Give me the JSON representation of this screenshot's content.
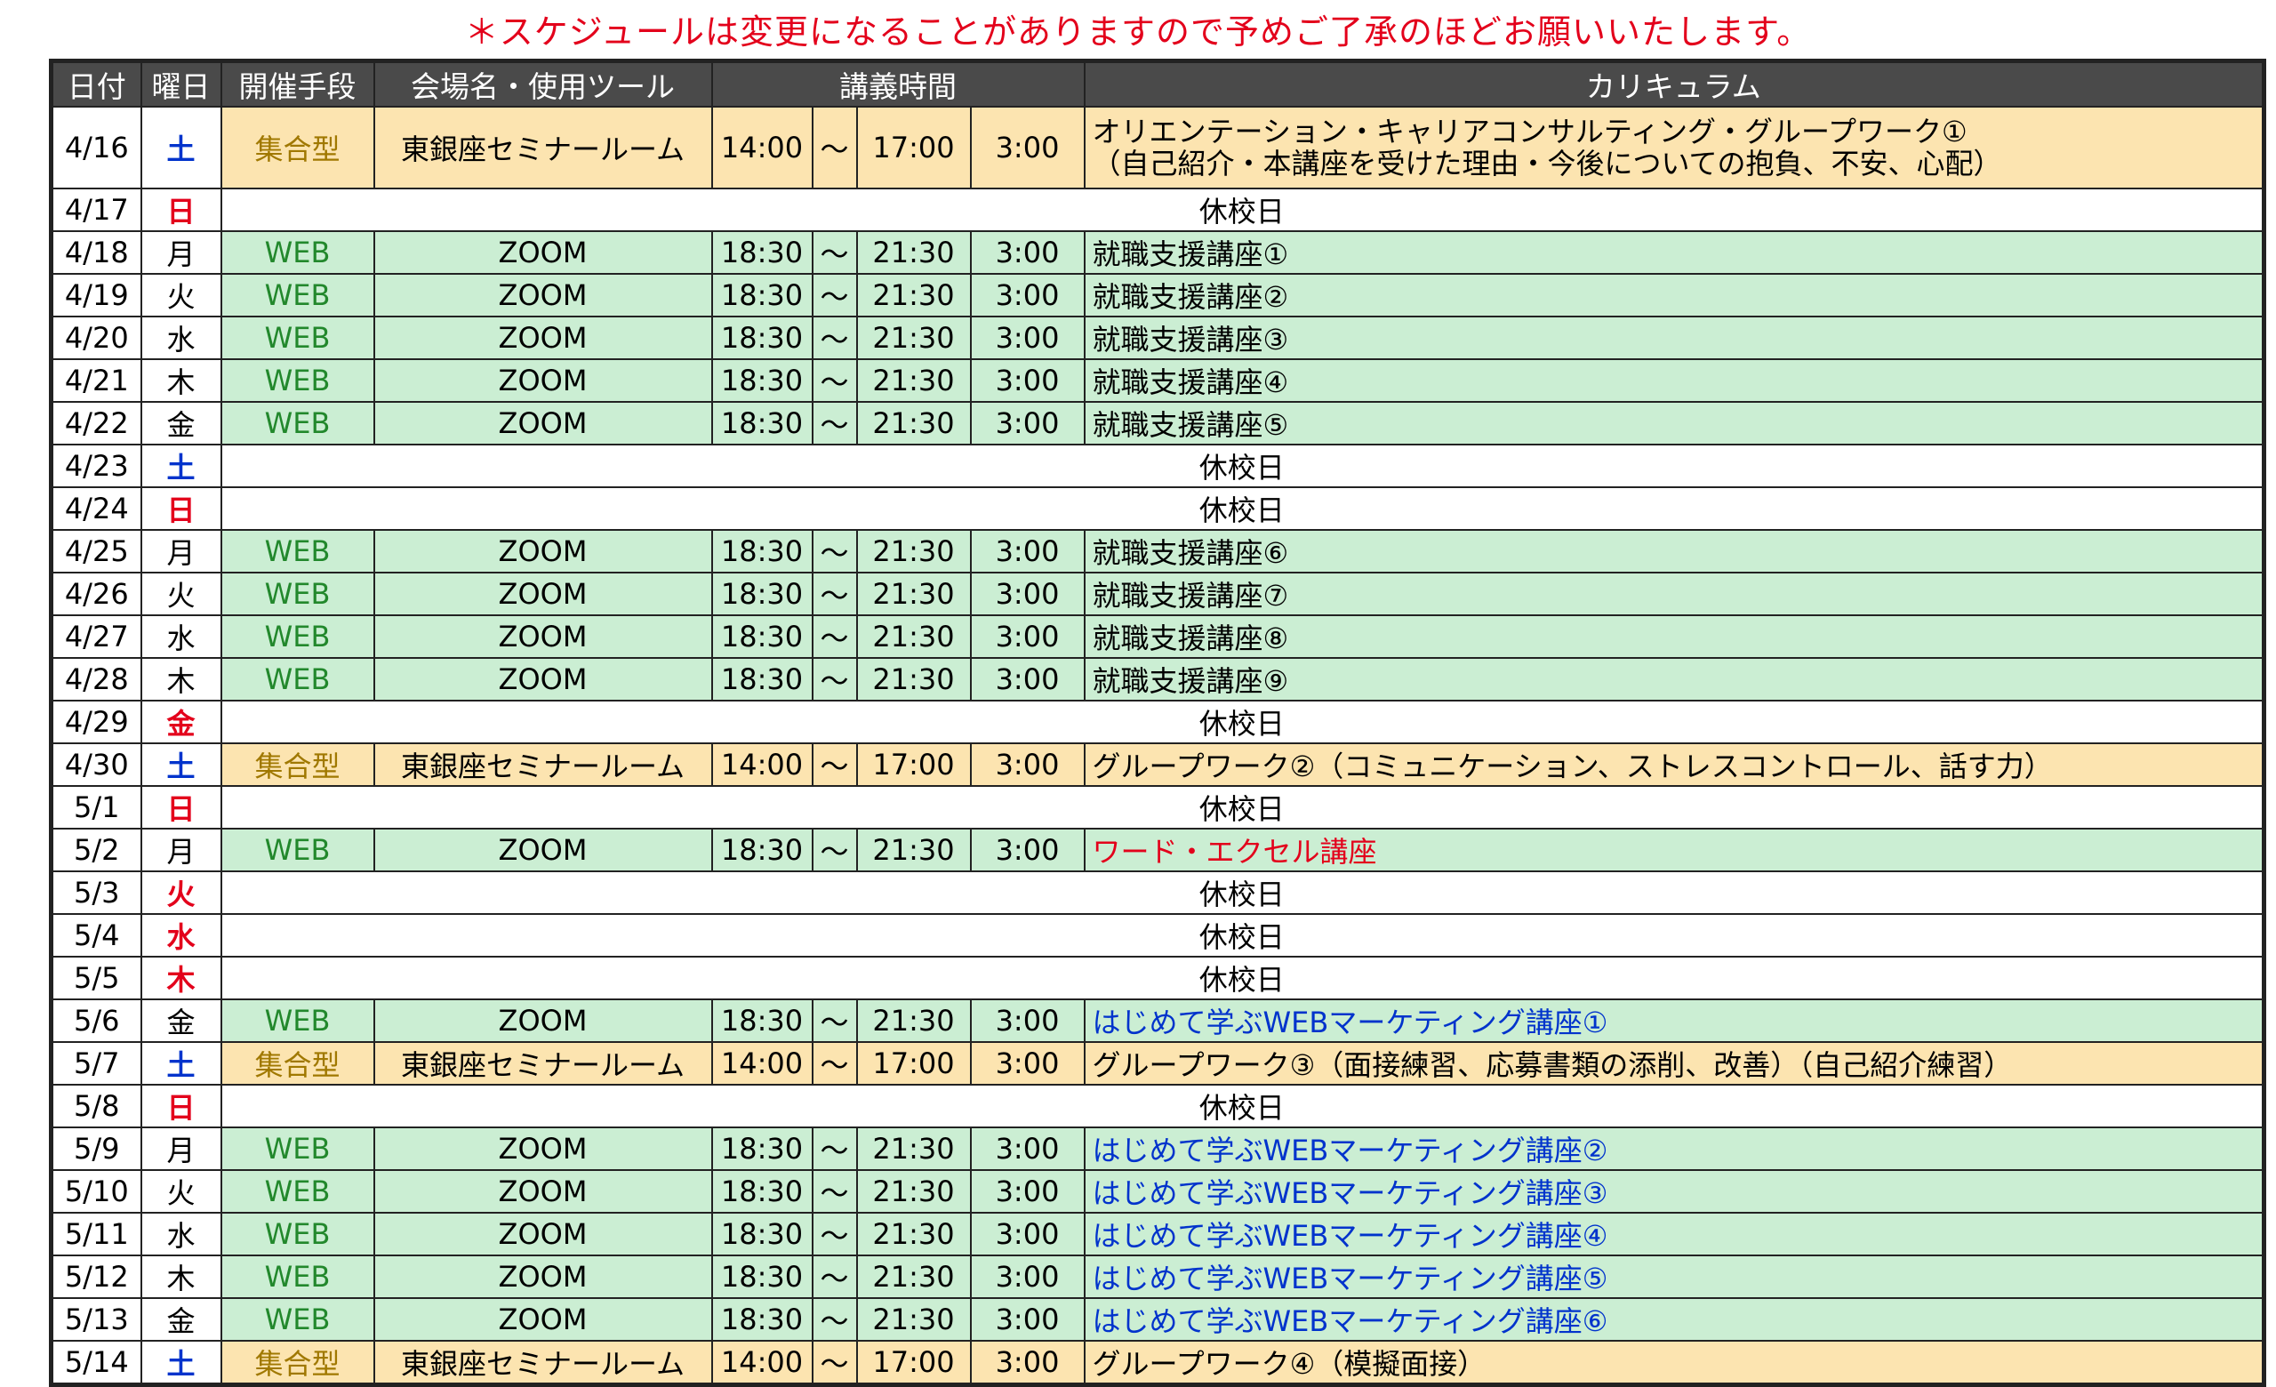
{
  "notice": "＊スケジュールは変更になることがありますので予めご了承のほどお願いいたします。",
  "headers": {
    "date": "日付",
    "day": "曜日",
    "method": "開催手段",
    "venue": "会場名・使用ツール",
    "time": "講義時間",
    "curriculum": "カリキュラム"
  },
  "rows": [
    {
      "date": "4/16",
      "day": "土",
      "day_color": "blue",
      "type": "group",
      "method": "集合型",
      "venue": "東銀座セミナールーム",
      "start": "14:00",
      "sep": "～",
      "end": "17:00",
      "dur": "3:00",
      "curriculum": "オリエンテーション・キャリアコンサルティング・グループワーク①",
      "curriculum2": "（自己紹介・本講座を受けた理由・今後についての抱負、不安、心配）",
      "cur_color": "black"
    },
    {
      "date": "4/17",
      "day": "日",
      "day_color": "red",
      "type": "holiday",
      "text": "休校日"
    },
    {
      "date": "4/18",
      "day": "月",
      "day_color": "black",
      "type": "web",
      "method": "WEB",
      "venue": "ZOOM",
      "start": "18:30",
      "sep": "～",
      "end": "21:30",
      "dur": "3:00",
      "curriculum": "就職支援講座①",
      "cur_color": "black"
    },
    {
      "date": "4/19",
      "day": "火",
      "day_color": "black",
      "type": "web",
      "method": "WEB",
      "venue": "ZOOM",
      "start": "18:30",
      "sep": "～",
      "end": "21:30",
      "dur": "3:00",
      "curriculum": "就職支援講座②",
      "cur_color": "black"
    },
    {
      "date": "4/20",
      "day": "水",
      "day_color": "black",
      "type": "web",
      "method": "WEB",
      "venue": "ZOOM",
      "start": "18:30",
      "sep": "～",
      "end": "21:30",
      "dur": "3:00",
      "curriculum": "就職支援講座③",
      "cur_color": "black"
    },
    {
      "date": "4/21",
      "day": "木",
      "day_color": "black",
      "type": "web",
      "method": "WEB",
      "venue": "ZOOM",
      "start": "18:30",
      "sep": "～",
      "end": "21:30",
      "dur": "3:00",
      "curriculum": "就職支援講座④",
      "cur_color": "black"
    },
    {
      "date": "4/22",
      "day": "金",
      "day_color": "black",
      "type": "web",
      "method": "WEB",
      "venue": "ZOOM",
      "start": "18:30",
      "sep": "～",
      "end": "21:30",
      "dur": "3:00",
      "curriculum": "就職支援講座⑤",
      "cur_color": "black"
    },
    {
      "date": "4/23",
      "day": "土",
      "day_color": "blue",
      "type": "holiday",
      "text": "休校日"
    },
    {
      "date": "4/24",
      "day": "日",
      "day_color": "red",
      "type": "holiday",
      "text": "休校日"
    },
    {
      "date": "4/25",
      "day": "月",
      "day_color": "black",
      "type": "web",
      "method": "WEB",
      "venue": "ZOOM",
      "start": "18:30",
      "sep": "～",
      "end": "21:30",
      "dur": "3:00",
      "curriculum": "就職支援講座⑥",
      "cur_color": "black"
    },
    {
      "date": "4/26",
      "day": "火",
      "day_color": "black",
      "type": "web",
      "method": "WEB",
      "venue": "ZOOM",
      "start": "18:30",
      "sep": "～",
      "end": "21:30",
      "dur": "3:00",
      "curriculum": "就職支援講座⑦",
      "cur_color": "black"
    },
    {
      "date": "4/27",
      "day": "水",
      "day_color": "black",
      "type": "web",
      "method": "WEB",
      "venue": "ZOOM",
      "start": "18:30",
      "sep": "～",
      "end": "21:30",
      "dur": "3:00",
      "curriculum": "就職支援講座⑧",
      "cur_color": "black"
    },
    {
      "date": "4/28",
      "day": "木",
      "day_color": "black",
      "type": "web",
      "method": "WEB",
      "venue": "ZOOM",
      "start": "18:30",
      "sep": "～",
      "end": "21:30",
      "dur": "3:00",
      "curriculum": "就職支援講座⑨",
      "cur_color": "black"
    },
    {
      "date": "4/29",
      "day": "金",
      "day_color": "red",
      "type": "holiday",
      "text": "休校日"
    },
    {
      "date": "4/30",
      "day": "土",
      "day_color": "blue",
      "type": "group",
      "method": "集合型",
      "venue": "東銀座セミナールーム",
      "start": "14:00",
      "sep": "～",
      "end": "17:00",
      "dur": "3:00",
      "curriculum": "グループワーク②（コミュニケーション、ストレスコントロール、話す力）",
      "cur_color": "black"
    },
    {
      "date": "5/1",
      "day": "日",
      "day_color": "red",
      "type": "holiday",
      "text": "休校日"
    },
    {
      "date": "5/2",
      "day": "月",
      "day_color": "black",
      "type": "web",
      "method": "WEB",
      "venue": "ZOOM",
      "start": "18:30",
      "sep": "～",
      "end": "21:30",
      "dur": "3:00",
      "curriculum": "ワード・エクセル講座",
      "cur_color": "red"
    },
    {
      "date": "5/3",
      "day": "火",
      "day_color": "red",
      "type": "holiday",
      "text": "休校日"
    },
    {
      "date": "5/4",
      "day": "水",
      "day_color": "red",
      "type": "holiday",
      "text": "休校日"
    },
    {
      "date": "5/5",
      "day": "木",
      "day_color": "red",
      "type": "holiday",
      "text": "休校日"
    },
    {
      "date": "5/6",
      "day": "金",
      "day_color": "black",
      "type": "web",
      "method": "WEB",
      "venue": "ZOOM",
      "start": "18:30",
      "sep": "～",
      "end": "21:30",
      "dur": "3:00",
      "curriculum": "はじめて学ぶWEBマーケティング講座①",
      "cur_color": "blue"
    },
    {
      "date": "5/7",
      "day": "土",
      "day_color": "blue",
      "type": "group",
      "method": "集合型",
      "venue": "東銀座セミナールーム",
      "start": "14:00",
      "sep": "～",
      "end": "17:00",
      "dur": "3:00",
      "curriculum": "グループワーク③（面接練習、応募書類の添削、改善）（自己紹介練習）",
      "cur_color": "black"
    },
    {
      "date": "5/8",
      "day": "日",
      "day_color": "red",
      "type": "holiday",
      "text": "休校日"
    },
    {
      "date": "5/9",
      "day": "月",
      "day_color": "black",
      "type": "web",
      "method": "WEB",
      "venue": "ZOOM",
      "start": "18:30",
      "sep": "～",
      "end": "21:30",
      "dur": "3:00",
      "curriculum": "はじめて学ぶWEBマーケティング講座②",
      "cur_color": "blue"
    },
    {
      "date": "5/10",
      "day": "火",
      "day_color": "black",
      "type": "web",
      "method": "WEB",
      "venue": "ZOOM",
      "start": "18:30",
      "sep": "～",
      "end": "21:30",
      "dur": "3:00",
      "curriculum": "はじめて学ぶWEBマーケティング講座③",
      "cur_color": "blue"
    },
    {
      "date": "5/11",
      "day": "水",
      "day_color": "black",
      "type": "web",
      "method": "WEB",
      "venue": "ZOOM",
      "start": "18:30",
      "sep": "～",
      "end": "21:30",
      "dur": "3:00",
      "curriculum": "はじめて学ぶWEBマーケティング講座④",
      "cur_color": "blue"
    },
    {
      "date": "5/12",
      "day": "木",
      "day_color": "black",
      "type": "web",
      "method": "WEB",
      "venue": "ZOOM",
      "start": "18:30",
      "sep": "～",
      "end": "21:30",
      "dur": "3:00",
      "curriculum": "はじめて学ぶWEBマーケティング講座⑤",
      "cur_color": "blue"
    },
    {
      "date": "5/13",
      "day": "金",
      "day_color": "black",
      "type": "web",
      "method": "WEB",
      "venue": "ZOOM",
      "start": "18:30",
      "sep": "～",
      "end": "21:30",
      "dur": "3:00",
      "curriculum": "はじめて学ぶWEBマーケティング講座⑥",
      "cur_color": "blue"
    },
    {
      "date": "5/14",
      "day": "土",
      "day_color": "blue",
      "type": "group",
      "method": "集合型",
      "venue": "東銀座セミナールーム",
      "start": "14:00",
      "sep": "～",
      "end": "17:00",
      "dur": "3:00",
      "curriculum": "グループワーク④（模擬面接）",
      "cur_color": "black"
    }
  ]
}
